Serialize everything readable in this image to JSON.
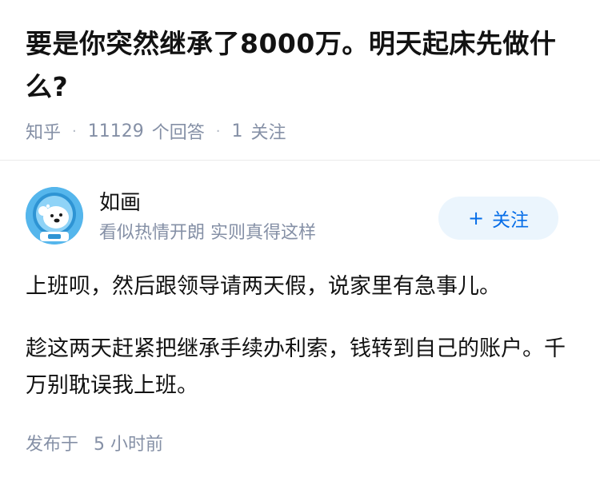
{
  "question": {
    "title": "要是你突然继承了8000万。明天起床先做什么?",
    "source": "知乎",
    "answer_count": "11129",
    "answer_label": "个回答",
    "follower_count": "1",
    "follower_label": "关注"
  },
  "answer": {
    "author": {
      "name": "如画",
      "bio": "看似热情开朗 实则真得这样",
      "avatar_icon": "bear-astronaut-avatar-icon",
      "follow_label": "关注",
      "follow_icon": "plus-icon"
    },
    "paragraphs": [
      "上班呗，然后跟领导请两天假，说家里有急事儿。",
      "趁这两天赶紧把继承手续办利索，钱转到自己的账户。千万别耽误我上班。"
    ],
    "published_label": "发布于",
    "published_time": "5 小时前"
  },
  "colors": {
    "accent": "#056de8",
    "follow_bg": "#ebf5fd",
    "meta_text": "#8590a6",
    "avatar_bg": "#55b6ec"
  }
}
